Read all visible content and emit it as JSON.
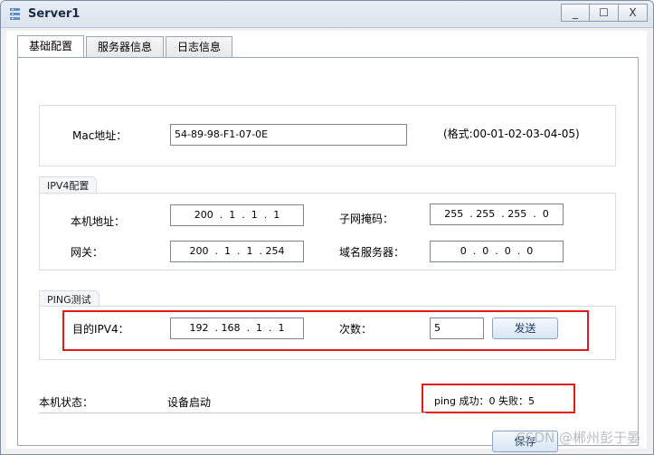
{
  "window": {
    "title": "Server1",
    "minimize": "_",
    "maximize": "☐",
    "close": "X"
  },
  "tabs": [
    {
      "label": "基础配置"
    },
    {
      "label": "服务器信息"
    },
    {
      "label": "日志信息"
    }
  ],
  "mac": {
    "label": "Mac地址：",
    "value": "54-89-98-F1-07-0E",
    "format_hint": "(格式:00-01-02-03-04-05)"
  },
  "ipv4": {
    "group_label": "IPV4配置",
    "local_ip_label": "本机地址：",
    "local_ip": "200  .  1  .  1  .  1",
    "mask_label": "子网掩码：",
    "mask": "255  . 255  . 255  .  0",
    "gateway_label": "网关：",
    "gateway": "200  .  1  .  1  . 254",
    "dns_label": "域名服务器：",
    "dns": "0  .  0  .  0  .  0"
  },
  "ping": {
    "group_label": "PING测试",
    "target_label": "目的IPV4：",
    "target": "192  . 168  .  1  .  1",
    "count_label": "次数：",
    "count": "5",
    "send_button": "发送"
  },
  "status": {
    "label": "本机状态：",
    "value": "设备启动",
    "result": "ping 成功：0    失败：5"
  },
  "save_button": "保存",
  "watermark": "CSDN @郴州彭于晏",
  "colors": {
    "highlight": "#e21a1a",
    "accent": "#1f3a66"
  }
}
